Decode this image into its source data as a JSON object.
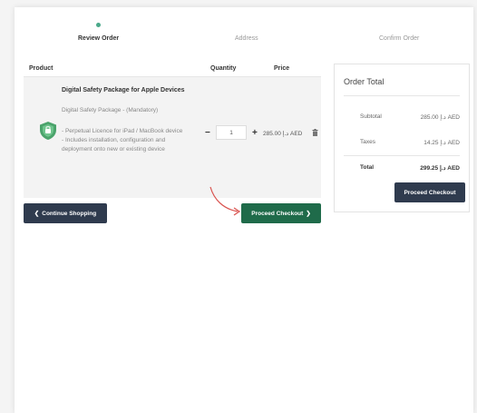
{
  "steps": [
    {
      "label": "Review Order",
      "active": true
    },
    {
      "label": "Address",
      "active": false
    },
    {
      "label": "Confirm Order",
      "active": false
    }
  ],
  "cart": {
    "headers": {
      "product": "Product",
      "quantity": "Quantity",
      "price": "Price"
    },
    "item": {
      "name": "Digital Safety Package for Apple Devices",
      "subtitle": "Digital Safety Package - (Mandatory)",
      "description": [
        "- Perpetual Licence for iPad / MacBook device",
        "- Includes installation, configuration and deployment onto new or existing device"
      ],
      "quantity": "1",
      "price": "285.00 د.إ AED",
      "icon": "shield-icon"
    }
  },
  "buttons": {
    "continue": "Continue Shopping",
    "proceed": "Proceed Checkout",
    "proceed_side": "Proceed Checkout"
  },
  "totals": {
    "title": "Order Total",
    "subtotal_label": "Subtotal",
    "subtotal_value": "285.00 د.إ AED",
    "taxes_label": "Taxes",
    "taxes_value": "14.25 د.إ AED",
    "total_label": "Total",
    "total_value": "299.25 د.إ AED"
  },
  "colors": {
    "accent_green": "#1f6b4a",
    "dark_navy": "#2f3b4e",
    "shield_green": "#4aa36b",
    "arrow_red": "#d9534f",
    "step_dot": "#4aa98a"
  }
}
